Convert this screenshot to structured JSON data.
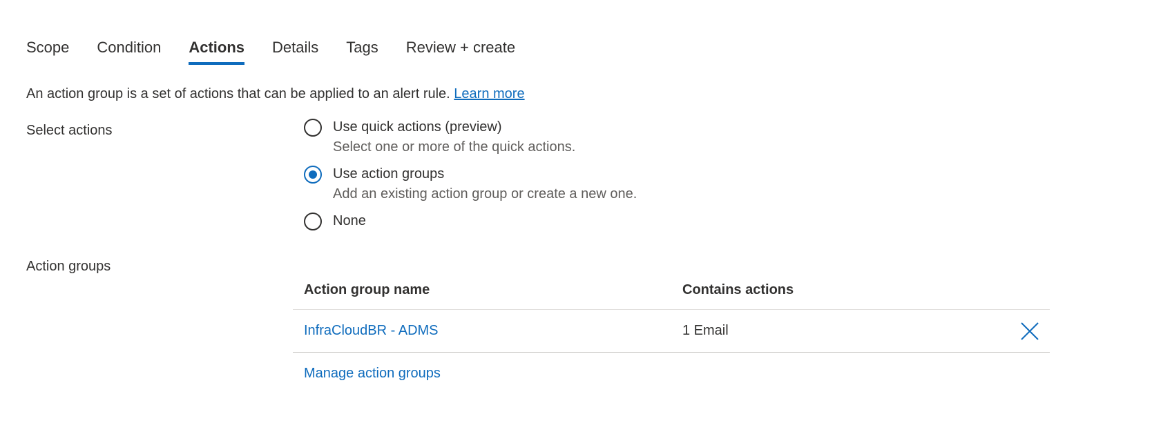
{
  "tabs": [
    {
      "label": "Scope",
      "active": false
    },
    {
      "label": "Condition",
      "active": false
    },
    {
      "label": "Actions",
      "active": true
    },
    {
      "label": "Details",
      "active": false
    },
    {
      "label": "Tags",
      "active": false
    },
    {
      "label": "Review + create",
      "active": false
    }
  ],
  "description": {
    "text": "An action group is a set of actions that can be applied to an alert rule.",
    "link": "Learn more"
  },
  "select_actions": {
    "label": "Select actions",
    "options": [
      {
        "label": "Use quick actions (preview)",
        "sublabel": "Select one or more of the quick actions.",
        "checked": false
      },
      {
        "label": "Use action groups",
        "sublabel": "Add an existing action group or create a new one.",
        "checked": true
      },
      {
        "label": "None",
        "sublabel": "",
        "checked": false
      }
    ]
  },
  "action_groups": {
    "label": "Action groups",
    "columns": [
      "Action group name",
      "Contains actions"
    ],
    "rows": [
      {
        "name": "InfraCloudBR - ADMS",
        "contains": "1 Email",
        "delete_icon": "close-icon"
      }
    ],
    "manage_link": "Manage action groups"
  },
  "colors": {
    "accent": "#0f6cbd",
    "text": "#323130",
    "secondary_text": "#605e5c"
  }
}
